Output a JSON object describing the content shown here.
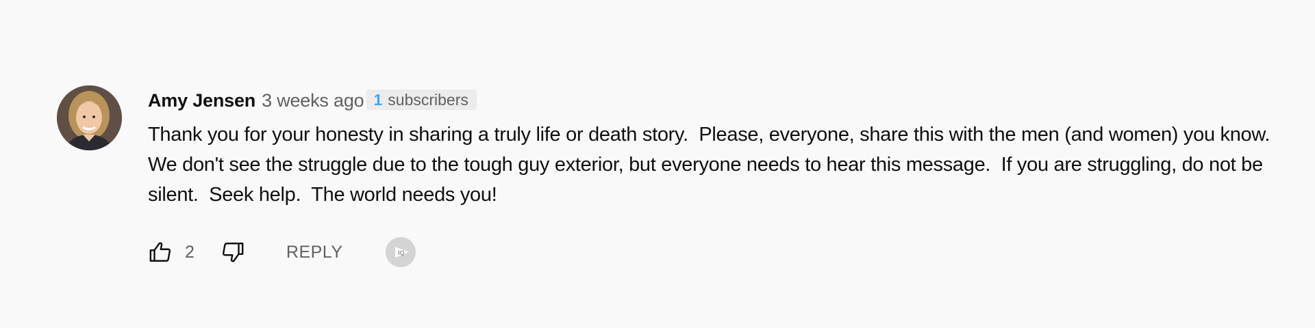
{
  "comment": {
    "author": "Amy Jensen",
    "timestamp": "3 weeks ago",
    "subscriber_count": "1",
    "subscriber_label": "subscribers",
    "text": "Thank you for your honesty in sharing a truly life or death story.  Please, everyone, share this with the men (and women) you know.  We don't see the struggle due to the tough guy exterior, but everyone needs to hear this message.  If you are struggling, do not be silent.  Seek help.  The world needs you!",
    "avatar_icon": "user-photo-avatar"
  },
  "actions": {
    "like_icon": "thumbs-up-icon",
    "like_count": "2",
    "dislike_icon": "thumbs-down-icon",
    "reply_label": "REPLY",
    "extension_icon": "iq-extension-icon",
    "extension_label": "IQ"
  },
  "colors": {
    "background": "#f9f9f9",
    "author": "#0f0f0f",
    "meta": "#606060",
    "subscriber_count": "#3ea6ff",
    "badge_bg": "#ececec"
  }
}
